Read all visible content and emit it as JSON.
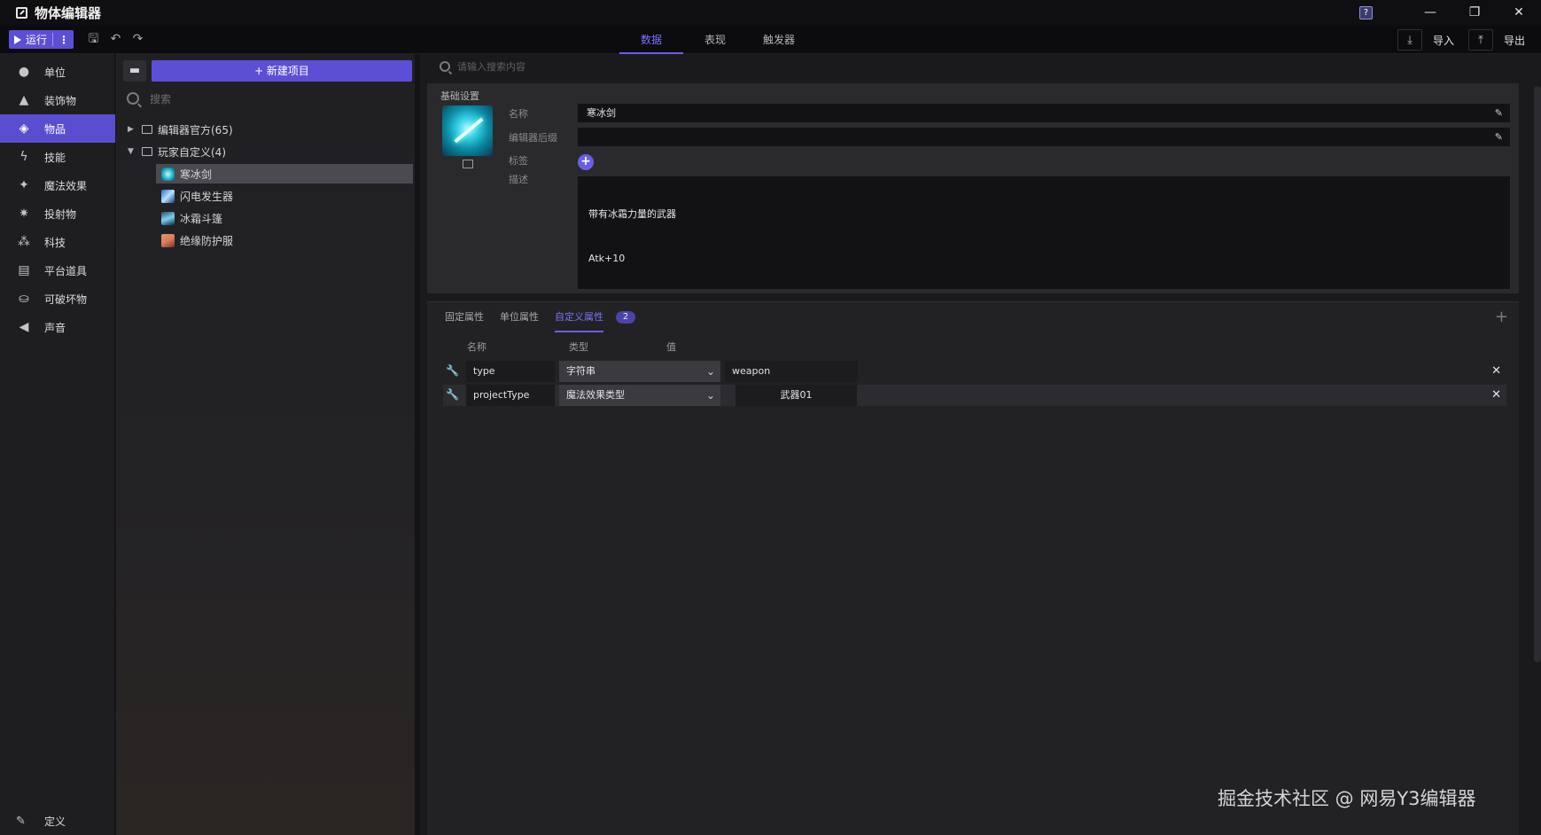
{
  "window": {
    "title": "物体编辑器",
    "help_label": "?"
  },
  "toolbar": {
    "run_label": "运行",
    "tabs": [
      "数据",
      "表现",
      "触发器"
    ],
    "active_tab": 0,
    "import_label": "导入",
    "export_label": "导出"
  },
  "sidebar": {
    "items": [
      {
        "label": "单位",
        "icon": "person-icon"
      },
      {
        "label": "装饰物",
        "icon": "tree-icon"
      },
      {
        "label": "物品",
        "icon": "cube-icon"
      },
      {
        "label": "技能",
        "icon": "lightning-icon"
      },
      {
        "label": "魔法效果",
        "icon": "sparkle-icon"
      },
      {
        "label": "投射物",
        "icon": "burst-icon"
      },
      {
        "label": "科技",
        "icon": "tech-icon"
      },
      {
        "label": "平台道具",
        "icon": "box-icon"
      },
      {
        "label": "可破坏物",
        "icon": "breakable-icon"
      },
      {
        "label": "声音",
        "icon": "speaker-icon"
      }
    ],
    "active_index": 2,
    "bottom_label": "定义"
  },
  "tree": {
    "new_button_label": "+ 新建项目",
    "search_placeholder": "搜索",
    "groups": [
      {
        "label": "编辑器官方(65)",
        "expanded": false
      },
      {
        "label": "玩家自定义(4)",
        "expanded": true
      }
    ],
    "items": [
      "寒冰剑",
      "闪电发生器",
      "冰霜斗篷",
      "绝缘防护服"
    ],
    "selected_index": 0
  },
  "main": {
    "search_placeholder": "请输入搜索内容",
    "basic": {
      "header": "基础设置",
      "name_label": "名称",
      "name_value": "寒冰剑",
      "suffix_label": "编辑器后缀",
      "suffix_value": "",
      "tag_label": "标签",
      "desc_label": "描述",
      "desc_lines": [
        "带有冰霜力量的武器",
        "Atk+10"
      ]
    },
    "props": {
      "tabs": [
        "固定属性",
        "单位属性",
        "自定义属性"
      ],
      "active_tab": 2,
      "badge": "2",
      "columns": {
        "name": "名称",
        "type": "类型",
        "value": "值"
      },
      "rows": [
        {
          "name": "type",
          "type": "字符串",
          "value": "weapon"
        },
        {
          "name": "projectType",
          "type": "魔法效果类型",
          "value": "武器01"
        }
      ]
    }
  },
  "watermark": "掘金技术社区 @ 网易Y3编辑器",
  "colors": {
    "accent": "#5b4fd6",
    "accent_text": "#7c72ff"
  }
}
